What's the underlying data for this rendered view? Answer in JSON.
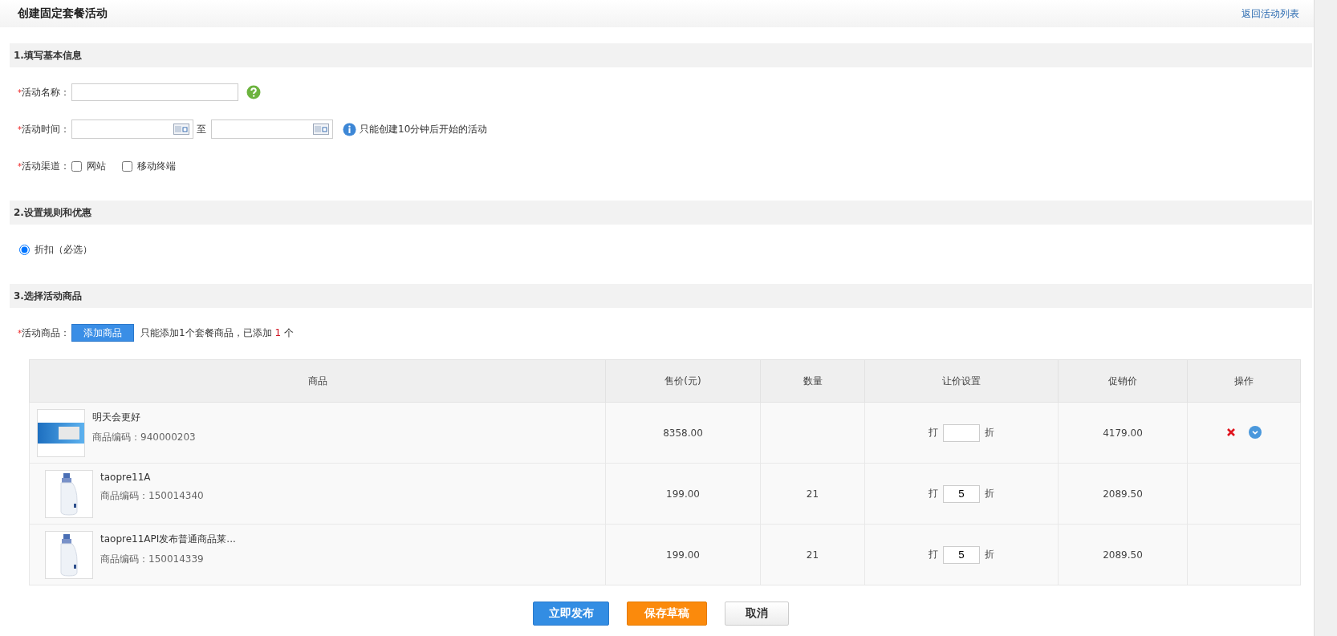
{
  "header": {
    "title": "创建固定套餐活动",
    "back_link": "返回活动列表"
  },
  "sections": [
    {
      "title": "1.填写基本信息",
      "fields": [
        {
          "kind": "text",
          "required": "*",
          "label": "活动名称：",
          "help": true
        },
        {
          "kind": "daterange",
          "required": "*",
          "label": "活动时间：",
          "separator": "至",
          "note": "只能创建10分钟后开始的活动"
        },
        {
          "kind": "checks",
          "required": "*",
          "label": "活动渠道：",
          "options": [
            {
              "label": "网站",
              "checked": false
            },
            {
              "label": "移动终端",
              "checked": false
            }
          ]
        }
      ]
    },
    {
      "title": "2.设置规则和优惠",
      "fields": [
        {
          "kind": "radios",
          "options": [
            {
              "label": "折扣（必选）",
              "selected": true
            }
          ]
        }
      ]
    },
    {
      "title": "3.选择活动商品",
      "fields": [
        {
          "kind": "products",
          "required": "*",
          "label": "活动商品：",
          "button": "添加商品",
          "note_before": "只能添加1个套餐商品，已添加",
          "count": "1",
          "note_after": "个"
        }
      ]
    }
  ],
  "table": {
    "columns": [
      "商品",
      "售价(元)",
      "数量",
      "让价设置",
      "促销价",
      "操作"
    ],
    "rows": [
      {
        "kind": "screen",
        "name": "明天会更好",
        "code": "商品编码：940000203",
        "price": "8358.00",
        "discount_prefix": "打",
        "discount_suffix": "折",
        "promo_price": "4179.00",
        "show_actions": true,
        "children": [
          {
            "kind": "bottle",
            "name": "taopre11A",
            "code": "商品编码：150014340",
            "price": "199.00",
            "quantity": "21",
            "discount_prefix": "打",
            "discount": "5",
            "discount_suffix": "折",
            "promo_price": "2089.50",
            "show_actions": false
          },
          {
            "kind": "bottle",
            "name": "taopre11API发布普通商品莱...",
            "code": "商品编码：150014339",
            "price": "199.00",
            "quantity": "21",
            "discount_prefix": "打",
            "discount": "5",
            "discount_suffix": "折",
            "promo_price": "2089.50",
            "show_actions": false
          }
        ]
      }
    ]
  },
  "buttons": [
    {
      "kind": "primary",
      "label": "立即发布"
    },
    {
      "kind": "warning",
      "label": "保存草稿"
    },
    {
      "kind": "default",
      "label": "取消"
    }
  ]
}
